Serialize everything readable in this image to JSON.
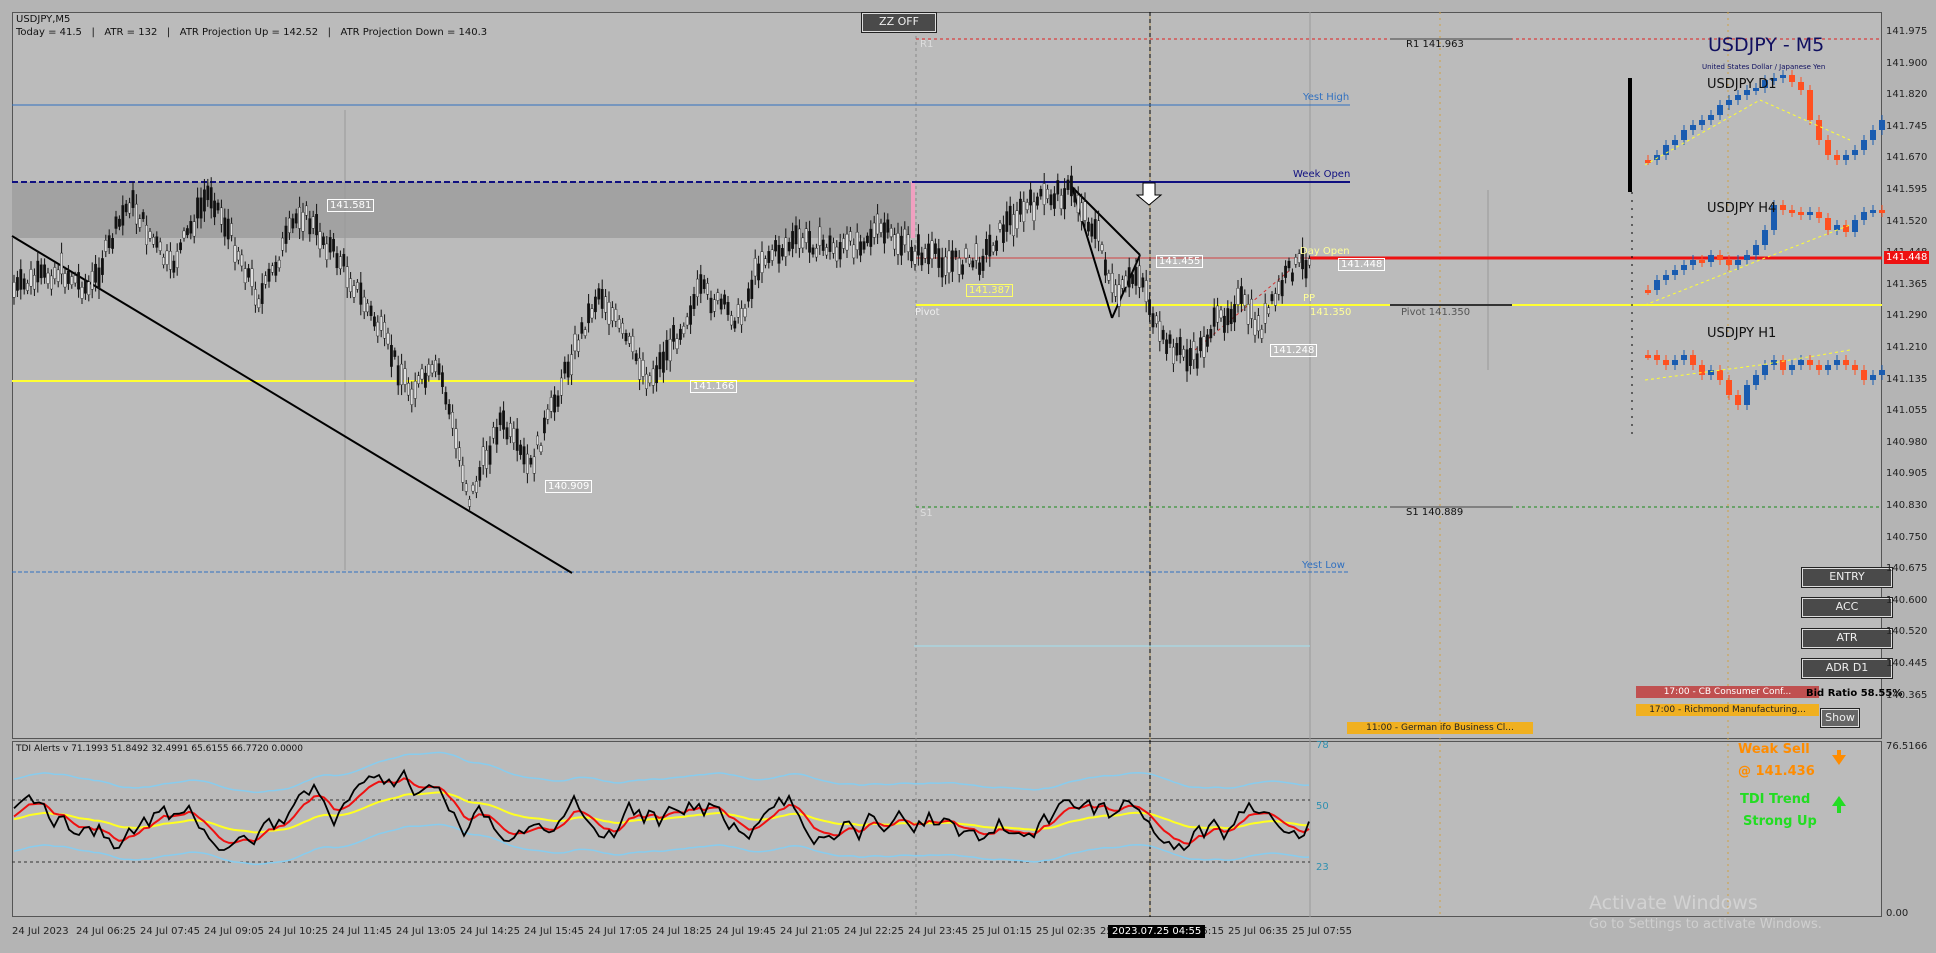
{
  "header": {
    "symbol": "USDJPY,M5",
    "stats": "Today = 41.5   |   ATR = 132   |   ATR Projection Up = 142.52   |   ATR Projection Down = 140.3"
  },
  "toolbar": {
    "zz_label": "ZZ OFF"
  },
  "panel": {
    "title": "USDJPY - M5",
    "subtitle": "United States Dollar / Japanese Yen",
    "tf_d1": "USDJPY D1",
    "tf_h4": "USDJPY H4",
    "tf_h1": "USDJPY H1"
  },
  "levels": {
    "r1_left": "R1",
    "r1_right": "R1 141.963",
    "yest_high": "Yest High",
    "week_open": "Week Open",
    "day_open": "Day Open",
    "pp": "PP",
    "pivot_left": "Pivot",
    "pivot_value": "141.350",
    "pivot_right": "Pivot 141.350",
    "s1_left": "S1",
    "s1_right": "S1 140.889",
    "yest_low": "Yest Low"
  },
  "price_labels": [
    "141.581",
    "141.387",
    "141.166",
    "140.909",
    "141.455",
    "141.248",
    "141.448"
  ],
  "buttons": {
    "entry": "ENTRY",
    "acc": "ACC",
    "atr": "ATR",
    "adr": "ADR D1",
    "show": "Show"
  },
  "news": {
    "cb": "17:00 - CB Consumer Conf...",
    "richmond": "17:00 - Richmond Manufacturing...",
    "german": "11:00 - German ifo Business Cl...",
    "bid_ratio": "Bid Ratio 58.55%"
  },
  "tdi": {
    "header": "TDI Alerts v 71.1993 51.8492 32.4991 65.6155 66.7720 0.0000",
    "level_hi": "78",
    "level_mid": "50",
    "level_lo": "23",
    "signal1": "Weak Sell",
    "signal1_price": "@ 141.436",
    "signal2a": "TDI Trend",
    "signal2b": "Strong Up",
    "scale_top": "76.5166",
    "scale_bot": "0.00"
  },
  "price_scale": [
    "141.975",
    "141.900",
    "141.820",
    "141.745",
    "141.670",
    "141.595",
    "141.520",
    "141.448",
    "141.365",
    "141.290",
    "141.210",
    "141.135",
    "141.055",
    "140.980",
    "140.905",
    "140.830",
    "140.750",
    "140.675",
    "140.600",
    "140.520",
    "140.445",
    "140.365"
  ],
  "current_price": "141.448",
  "time_scale": [
    "24 Jul 2023",
    "24 Jul 06:25",
    "24 Jul 07:45",
    "24 Jul 09:05",
    "24 Jul 10:25",
    "24 Jul 11:45",
    "24 Jul 13:05",
    "24 Jul 14:25",
    "24 Jul 15:45",
    "24 Jul 17:05",
    "24 Jul 18:25",
    "24 Jul 19:45",
    "24 Jul 21:05",
    "24 Jul 22:25",
    "24 Jul 23:45",
    "25 Jul 01:15",
    "25 Jul 02:35",
    "25 Jul 03:55",
    "25 Jul 05:15",
    "25 Jul 06:35",
    "25 Jul 07:55"
  ],
  "crosshair_time": "2023.07.25 04:55",
  "watermark": {
    "line1": "Activate Windows",
    "line2": "Go to Settings to activate Windows."
  },
  "colors": {
    "bg": "#bbbbbb",
    "yellow": "#ffff33",
    "red": "#ee1111",
    "navy": "#101080",
    "blue": "#3070c0",
    "orange": "#ff8c00",
    "green": "#22dd22"
  }
}
